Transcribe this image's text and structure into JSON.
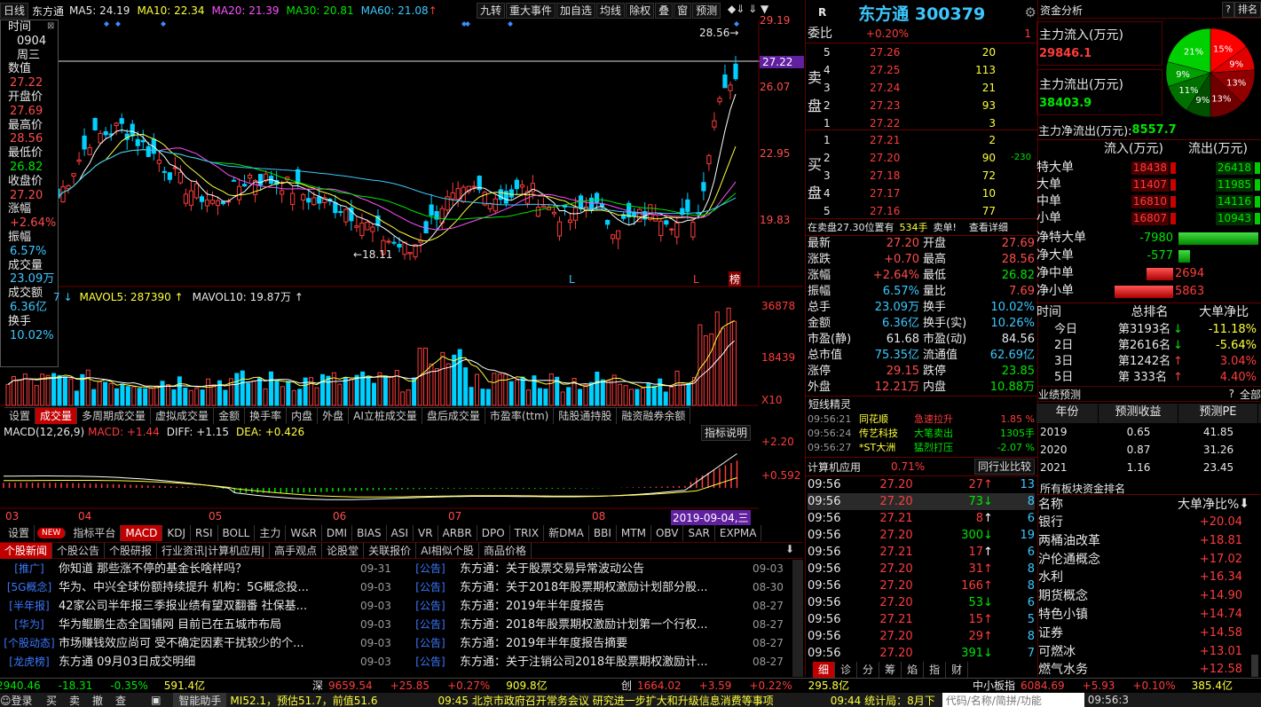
{
  "ma_bar": {
    "period": "日线",
    "name": "东方通",
    "ma5": "MA5: 24.19",
    "ma10": "MA10: 22.34",
    "ma20": "MA20: 21.39",
    "ma30": "MA30: 20.81",
    "ma60": "MA60: 21.08",
    "arrow": "↑"
  },
  "toolbar": [
    "九转",
    "重大事件",
    "加自选",
    "均线",
    "除权",
    "叠",
    "窗",
    "预测"
  ],
  "price_axis": [
    "29.19",
    "27.22",
    "26.07",
    "22.95",
    "19.83"
  ],
  "hi_mark": "28.56",
  "lo_mark": "18.11",
  "markers": {
    "l1": "L",
    "l2": "L",
    "bang": "榜"
  },
  "info_panel": {
    "items": [
      {
        "k": "时间",
        "v": "2019"
      },
      {
        "k": "",
        "v": "0904"
      },
      {
        "k": "",
        "v": "周三"
      },
      {
        "k": "数值",
        "v": ""
      },
      {
        "k": "",
        "v": "27.22"
      },
      {
        "k": "开盘价",
        "v": ""
      },
      {
        "k": "",
        "v": "27.69"
      },
      {
        "k": "最高价",
        "v": ""
      },
      {
        "k": "",
        "v": "28.56"
      },
      {
        "k": "最低价",
        "v": ""
      },
      {
        "k": "",
        "v": "26.82"
      },
      {
        "k": "收盘价",
        "v": ""
      },
      {
        "k": "",
        "v": "27.20"
      },
      {
        "k": "涨幅",
        "v": ""
      },
      {
        "k": "",
        "v": "+2.64%"
      },
      {
        "k": "振幅",
        "v": ""
      },
      {
        "k": "",
        "v": "6.57%"
      },
      {
        "k": "成交量",
        "v": ""
      },
      {
        "k": "",
        "v": "23.09万"
      },
      {
        "k": "成交额",
        "v": ""
      },
      {
        "k": "",
        "v": "6.36亿"
      },
      {
        "k": "换手",
        "v": ""
      },
      {
        "k": "",
        "v": "10.02%"
      }
    ]
  },
  "vol_bar": {
    "a": "7 ↓",
    "b": "MAVOL5: 287390 ↑",
    "c": "MAVOL10: 19.87万 ↑"
  },
  "vol_axis": [
    "36878",
    "18439"
  ],
  "vol_unit": "X10",
  "vol_tabs": [
    "设置",
    "成交量",
    "多周期成交量",
    "虚拟成交量",
    "金额",
    "换手率",
    "内盘",
    "外盘",
    "AI立桩成交量",
    "盘后成交量",
    "市盈率(ttm)",
    "陆股通持股",
    "融资融券余额"
  ],
  "macd_bar": {
    "a": "MACD(12,26,9)",
    "b": "MACD: +1.44",
    "c": "DIFF: +1.15",
    "d": "DEA: +0.426",
    "btn": "指标说明"
  },
  "macd_axis": [
    "+2.20",
    "+0.592"
  ],
  "x_axis": [
    "03",
    "04",
    "05",
    "06",
    "07",
    "08",
    "2019-09-04,三"
  ],
  "ind_tabs": [
    "设置",
    "NEW",
    "指标平台",
    "MACD",
    "KDJ",
    "RSI",
    "BOLL",
    "主力",
    "W&R",
    "DMI",
    "BIAS",
    "ASI",
    "VR",
    "ARBR",
    "DPO",
    "TRIX",
    "新DMA",
    "BBI",
    "MTM",
    "OBV",
    "SAR",
    "EXPMA"
  ],
  "news_tabs": [
    "个股新闻",
    "个股公告",
    "个股研报",
    "行业资讯|计算机应用|",
    "高手观点",
    "论股堂",
    "关联报价",
    "AI相似个股",
    "商品价格"
  ],
  "news_left": [
    {
      "tag": "推广",
      "t": "你知道 那些涨不停的基金长啥样吗？",
      "d": "09-31"
    },
    {
      "tag": "5G概念",
      "t": "华为、中兴全球份额持续提升 机构：5G概念投...",
      "d": "09-03"
    },
    {
      "tag": "半年报",
      "t": "42家公司半年报三季报业绩有望双翻番 社保基...",
      "d": "09-03"
    },
    {
      "tag": "华为",
      "t": "华为鲲鹏生态全国铺网 目前已在五城市布局",
      "d": "09-03"
    },
    {
      "tag": "个股动态",
      "t": "市场赚钱效应尚可 受不确定因素干扰较少的个...",
      "d": "09-03"
    },
    {
      "tag": "龙虎榜",
      "t": "东方通 09月03日成交明细",
      "d": "09-03"
    }
  ],
  "news_right": [
    {
      "tag": "公告",
      "t": "东方通：关于股票交易异常波动公告",
      "d": "09-03"
    },
    {
      "tag": "公告",
      "t": "东方通：关于2018年股票期权激励计划部分股...",
      "d": "08-30"
    },
    {
      "tag": "公告",
      "t": "东方通：2019年半年度报告",
      "d": "08-27"
    },
    {
      "tag": "公告",
      "t": "东方通：2018年股票期权激励计划第一个行权...",
      "d": "08-27"
    },
    {
      "tag": "公告",
      "t": "东方通：2019年半年度报告摘要",
      "d": "08-27"
    },
    {
      "tag": "公告",
      "t": "东方通：关于注销公司2018年股票期权激励计...",
      "d": "08-27"
    }
  ],
  "stock": {
    "r": "R",
    "title": "东方通 300379"
  },
  "weibi": {
    "k": "委比",
    "v": "+0.20%",
    "n": "1"
  },
  "sell": [
    {
      "l": "5",
      "p": "27.26",
      "q": "20"
    },
    {
      "l": "4",
      "p": "27.25",
      "q": "113"
    },
    {
      "l": "3",
      "p": "27.24",
      "q": "21"
    },
    {
      "l": "2",
      "p": "27.23",
      "q": "93"
    },
    {
      "l": "1",
      "p": "27.22",
      "q": "3"
    }
  ],
  "buy": [
    {
      "l": "1",
      "p": "27.21",
      "q": "2",
      "x": ""
    },
    {
      "l": "2",
      "p": "27.20",
      "q": "90",
      "x": "-230"
    },
    {
      "l": "3",
      "p": "27.18",
      "q": "72",
      "x": ""
    },
    {
      "l": "4",
      "p": "27.17",
      "q": "10",
      "x": ""
    },
    {
      "l": "5",
      "p": "27.16",
      "q": "77",
      "x": ""
    }
  ],
  "sell_label": "卖盘",
  "buy_label": "买盘",
  "sellinfo": {
    "a": "在卖盘27.30位置有",
    "b": "534手",
    "c": "卖单!",
    "d": "查看详细"
  },
  "quote": [
    {
      "k1": "最新",
      "v1": "27.20",
      "k2": "开盘",
      "v2": "27.69"
    },
    {
      "k1": "涨跌",
      "v1": "+0.70",
      "k2": "最高",
      "v2": "28.56"
    },
    {
      "k1": "涨幅",
      "v1": "+2.64%",
      "k2": "最低",
      "v2": "26.82"
    },
    {
      "k1": "振幅",
      "v1": "6.57%",
      "k2": "量比",
      "v2": "7.69"
    },
    {
      "k1": "总手",
      "v1": "23.09万",
      "k2": "换手",
      "v2": "10.02%"
    },
    {
      "k1": "金额",
      "v1": "6.36亿",
      "k2": "换手(实)",
      "v2": "10.26%"
    },
    {
      "k1": "市盈(静)",
      "v1": "61.68",
      "k2": "市盈(动)",
      "v2": "84.56"
    },
    {
      "k1": "总市值",
      "v1": "75.35亿",
      "k2": "流通值",
      "v2": "62.69亿"
    },
    {
      "k1": "涨停",
      "v1": "29.15",
      "k2": "跌停",
      "v2": "23.85"
    },
    {
      "k1": "外盘",
      "v1": "12.21万",
      "k2": "内盘",
      "v2": "10.88万"
    }
  ],
  "elves": {
    "title": "短线精灵",
    "rows": [
      {
        "t": "09:56:21",
        "n": "同花顺",
        "e": "急速拉升",
        "v": "1.85 %"
      },
      {
        "t": "09:56:24",
        "n": "传艺科技",
        "e": "大笔卖出",
        "v": "1305手"
      },
      {
        "t": "09:56:27",
        "n": "*ST大洲",
        "e": "猛烈打压",
        "v": "-2.07 %"
      }
    ]
  },
  "industry": {
    "name": "计算机应用",
    "pct": "0.71%",
    "btn": "同行业比较"
  },
  "ticks": [
    {
      "t": "09:56",
      "p": "27.20",
      "q": "27",
      "d": "↑",
      "n": "13"
    },
    {
      "t": "09:56",
      "p": "27.20",
      "q": "73",
      "d": "↓",
      "n": "8"
    },
    {
      "t": "09:56",
      "p": "27.21",
      "q": "8",
      "d": "↑",
      "n": "6"
    },
    {
      "t": "09:56",
      "p": "27.20",
      "q": "300",
      "d": "↓",
      "n": "19"
    },
    {
      "t": "09:56",
      "p": "27.21",
      "q": "17",
      "d": "↑",
      "n": "6"
    },
    {
      "t": "09:56",
      "p": "27.20",
      "q": "31",
      "d": "↑",
      "n": "8"
    },
    {
      "t": "09:56",
      "p": "27.20",
      "q": "166",
      "d": "↑",
      "n": "8"
    },
    {
      "t": "09:56",
      "p": "27.20",
      "q": "53",
      "d": "↓",
      "n": "6"
    },
    {
      "t": "09:56",
      "p": "27.21",
      "q": "15",
      "d": "↑",
      "n": "5"
    },
    {
      "t": "09:56",
      "p": "27.20",
      "q": "29",
      "d": "↑",
      "n": "8"
    },
    {
      "t": "09:56",
      "p": "27.20",
      "q": "391",
      "d": "↓",
      "n": "7"
    }
  ],
  "tick_tabs": [
    "细",
    "诊",
    "分",
    "筹",
    "焰",
    "指",
    "财"
  ],
  "fund": {
    "title": "资金分析",
    "help": "?",
    "rank": "排名",
    "in_label": "主力流入(万元)",
    "in_v": "29846.1",
    "out_label": "主力流出(万元)",
    "out_v": "38403.9",
    "net_label": "主力净流出(万元):",
    "net_v": "8557.7",
    "pie": [
      {
        "v": "15%",
        "c": "#ff0000"
      },
      {
        "v": "9%",
        "c": "#e00000"
      },
      {
        "v": "13%",
        "c": "#900000"
      },
      {
        "v": "13%",
        "c": "#700000"
      },
      {
        "v": "9%",
        "c": "#005000"
      },
      {
        "v": "11%",
        "c": "#007000"
      },
      {
        "v": "9%",
        "c": "#00a000"
      },
      {
        "v": "21%",
        "c": "#00d000"
      }
    ],
    "cols": [
      "流入(万元)",
      "流出(万元)"
    ],
    "rows": [
      {
        "k": "特大单",
        "a": "18438",
        "b": "26418"
      },
      {
        "k": "大单",
        "a": "11407",
        "b": "11985"
      },
      {
        "k": "中单",
        "a": "16810",
        "b": "14116"
      },
      {
        "k": "小单",
        "a": "16807",
        "b": "10943"
      }
    ],
    "net": [
      {
        "k": "净特大单",
        "v": "-7980",
        "s": "neg",
        "f": 1.0
      },
      {
        "k": "净大单",
        "v": "-577",
        "s": "neg",
        "f": 0.14
      },
      {
        "k": "净中单",
        "v": "2694",
        "s": "pos",
        "f": 0.2
      },
      {
        "k": "净小单",
        "v": "5863",
        "s": "pos",
        "f": 0.44
      }
    ]
  },
  "rank": {
    "h": [
      "时间",
      "总排名",
      "大单净比"
    ],
    "rows": [
      {
        "a": "今日",
        "b": "第3193名",
        "d": "↓",
        "c": "-11.18%"
      },
      {
        "a": "2日",
        "b": "第2616名",
        "d": "↓",
        "c": "-5.64%"
      },
      {
        "a": "3日",
        "b": "第1242名",
        "d": "↑",
        "c": "3.04%"
      },
      {
        "a": "5日",
        "b": "第 333名",
        "d": "↑",
        "c": "4.40%"
      }
    ]
  },
  "forecast": {
    "title": "业绩预测",
    "help": "?",
    "all": "全部",
    "h": [
      "年份",
      "预测收益",
      "预测PE"
    ],
    "rows": [
      {
        "y": "2019",
        "e": "0.65",
        "pe": "41.85"
      },
      {
        "y": "2020",
        "e": "0.87",
        "pe": "31.26"
      },
      {
        "y": "2021",
        "e": "1.16",
        "pe": "23.45"
      }
    ]
  },
  "sectors": {
    "title": "所有板块资金排名",
    "h1": "名称",
    "h2": "大单净比%",
    "rows": [
      {
        "n": "银行",
        "v": "+20.04"
      },
      {
        "n": "两桶油改革",
        "v": "+18.81"
      },
      {
        "n": "沪伦通概念",
        "v": "+17.02"
      },
      {
        "n": "水利",
        "v": "+16.34"
      },
      {
        "n": "期货概念",
        "v": "+14.90"
      },
      {
        "n": "特色小镇",
        "v": "+14.74"
      },
      {
        "n": "证券",
        "v": "+14.58"
      },
      {
        "n": "可燃冰",
        "v": "+13.01"
      },
      {
        "n": "燃气水务",
        "v": "+12.58"
      }
    ]
  },
  "status": [
    {
      "n": "",
      "v": "2940.46",
      "c": "-18.31",
      "p": "-0.35%",
      "a": "591.4亿"
    },
    {
      "n": "深",
      "v": "9659.54",
      "c": "+25.85",
      "p": "+0.27%",
      "a": "909.8亿"
    },
    {
      "n": "创",
      "v": "1664.02",
      "c": "+3.59",
      "p": "+0.22%",
      "a": "295.8亿"
    },
    {
      "n": "中小板指",
      "v": "6084.69",
      "c": "+5.93",
      "p": "+0.10%",
      "a": "385.4亿"
    }
  ],
  "bottom": {
    "login": "登录",
    "buy": "买",
    "sell": "卖",
    "cancel": "撤",
    "query": "查",
    "asst": "智能助手",
    "ind": "MI52.1，预估51.7，前值51.6",
    "news1": "09:45 北京市政府召开常务会议 研究进一步扩大和升级信息消费等事项",
    "news2": "09:44 统计局：8月下",
    "search": "代码/名称/简拼/功能",
    "clock": "09:56:3"
  }
}
